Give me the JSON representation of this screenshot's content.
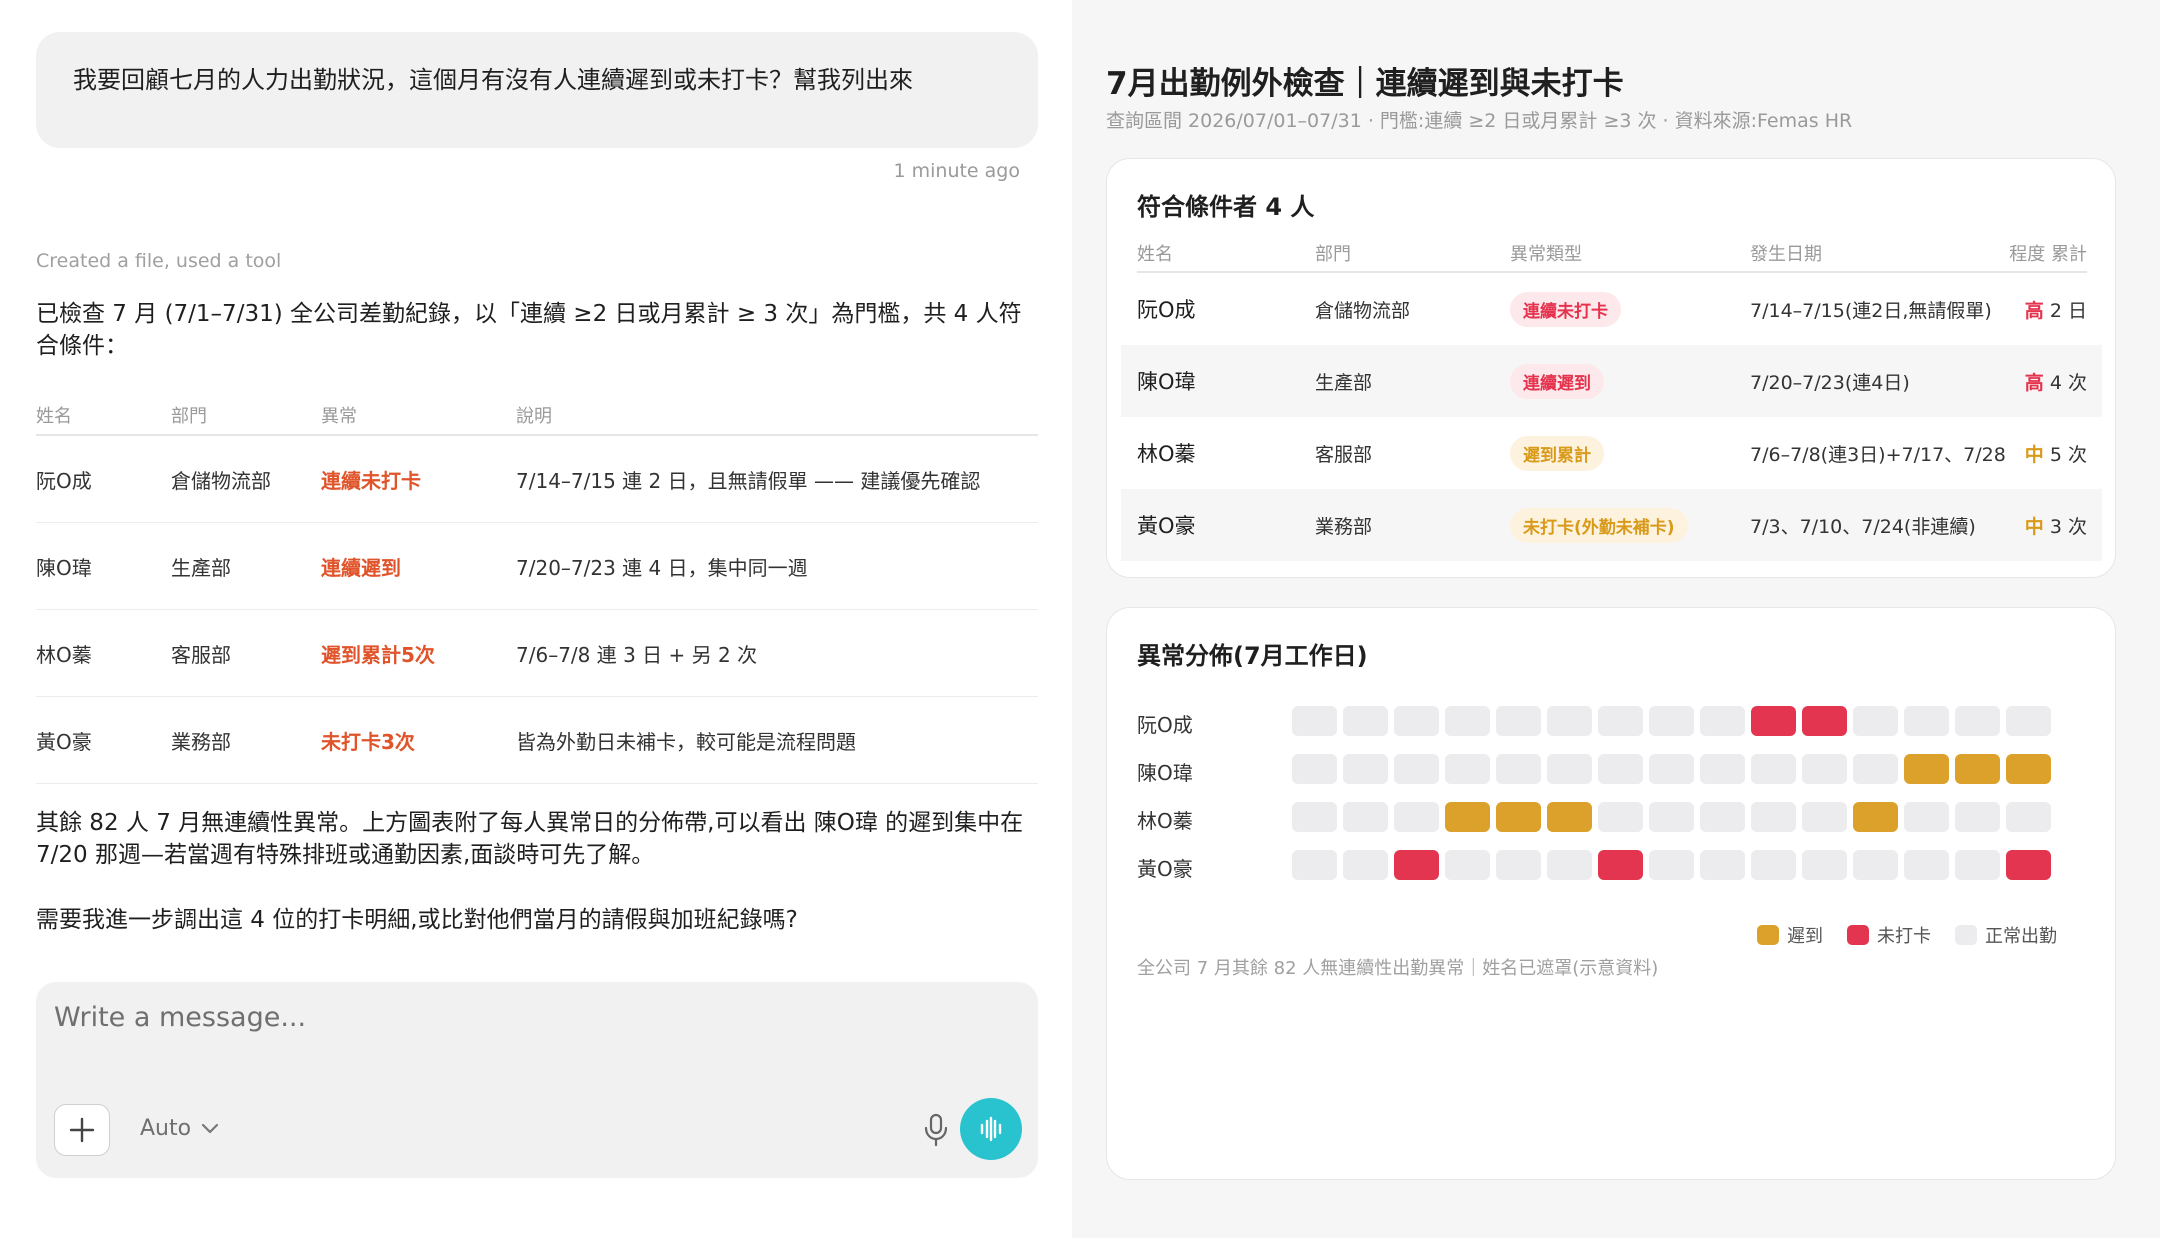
{
  "chat": {
    "user_message": "我要回顧七月的人力出勤狀況，這個月有沒有人連續遲到或未打卡？幫我列出來",
    "timestamp": "1 minute ago",
    "tool_note": "Created a file, used a tool",
    "intro": "已檢查 7 月 (7/1–7/31) 全公司差勤紀錄，以「連續 ≥2 日或月累計 ≥ 3 次」為門檻，共 4 人符合條件：",
    "table": {
      "headers": [
        "姓名",
        "部門",
        "異常",
        "說明"
      ],
      "rows": [
        {
          "name": "阮O成",
          "dept": "倉儲物流部",
          "type": "連續未打卡",
          "desc": "7/14–7/15 連 2 日，且無請假單 —— 建議優先確認"
        },
        {
          "name": "陳O瑋",
          "dept": "生產部",
          "type": "連續遲到",
          "desc": "7/20–7/23 連 4 日，集中同一週"
        },
        {
          "name": "林O蓁",
          "dept": "客服部",
          "type": "遲到累計5次",
          "desc": "7/6–7/8 連 3 日 + 另 2 次"
        },
        {
          "name": "黃O豪",
          "dept": "業務部",
          "type": "未打卡3次",
          "desc": "皆為外勤日未補卡，較可能是流程問題"
        }
      ]
    },
    "summary": "其餘 82 人 7 月無連續性異常。上方圖表附了每人異常日的分佈帶,可以看出 陳O瑋 的遲到集中在 7/20 那週—若當週有特殊排班或通勤因素,面談時可先了解。",
    "followup": "需要我進一步調出這 4 位的打卡明細,或比對他們當月的請假與加班紀錄嗎?",
    "composer": {
      "placeholder": "Write a message...",
      "model": "Auto"
    }
  },
  "artifact": {
    "title": "7月出勤例外檢查｜連續遲到與未打卡",
    "subtitle": "查詢區間 2026/07/01–07/31 · 門檻:連續 ≥2 日或月累計 ≥3 次 · 資料來源:Femas HR",
    "matches": {
      "title": "符合條件者 4 人",
      "headers": {
        "name": "姓名",
        "dept": "部門",
        "type": "異常類型",
        "date": "發生日期",
        "degree": "程度 累計"
      },
      "rows": [
        {
          "name": "阮O成",
          "dept": "倉儲物流部",
          "type": "連續未打卡",
          "type_color": "red",
          "date": "7/14–7/15(連2日,無請假單)",
          "level": "高",
          "level_color": "red",
          "count": "2 日"
        },
        {
          "name": "陳O瑋",
          "dept": "生產部",
          "type": "連續遲到",
          "type_color": "red",
          "date": "7/20–7/23(連4日)",
          "level": "高",
          "level_color": "red",
          "count": "4 次"
        },
        {
          "name": "林O蓁",
          "dept": "客服部",
          "type": "遲到累計",
          "type_color": "amber",
          "date": "7/6–7/8(連3日)+7/17、7/28",
          "level": "中",
          "level_color": "amber",
          "count": "5 次"
        },
        {
          "name": "黃O豪",
          "dept": "業務部",
          "type": "未打卡(外勤未補卡)",
          "type_color": "amber",
          "date": "7/3、7/10、7/24(非連續)",
          "level": "中",
          "level_color": "amber",
          "count": "3 次"
        }
      ]
    },
    "distribution": {
      "title": "異常分佈(7月工作日)",
      "rows": [
        {
          "name": "阮O成",
          "cells": [
            "n",
            "n",
            "n",
            "n",
            "n",
            "n",
            "n",
            "n",
            "n",
            "m",
            "m",
            "n",
            "n",
            "n",
            "n"
          ]
        },
        {
          "name": "陳O瑋",
          "cells": [
            "n",
            "n",
            "n",
            "n",
            "n",
            "n",
            "n",
            "n",
            "n",
            "n",
            "n",
            "n",
            "l",
            "l",
            "l"
          ]
        },
        {
          "name": "林O蓁",
          "cells": [
            "n",
            "n",
            "n",
            "l",
            "l",
            "l",
            "n",
            "n",
            "n",
            "n",
            "n",
            "l",
            "n",
            "n",
            "n"
          ]
        },
        {
          "name": "黃O豪",
          "cells": [
            "n",
            "n",
            "m",
            "n",
            "n",
            "n",
            "m",
            "n",
            "n",
            "n",
            "n",
            "n",
            "n",
            "n",
            "m"
          ]
        }
      ],
      "legend": {
        "late": "遲到",
        "missed": "未打卡",
        "normal": "正常出勤"
      },
      "colors": {
        "late": "#dca12a",
        "missed": "#e3354f",
        "normal": "#ececef"
      },
      "note": "全公司 7 月其餘 82 人無連續性出勤異常｜姓名已遮罩(示意資料)"
    }
  }
}
